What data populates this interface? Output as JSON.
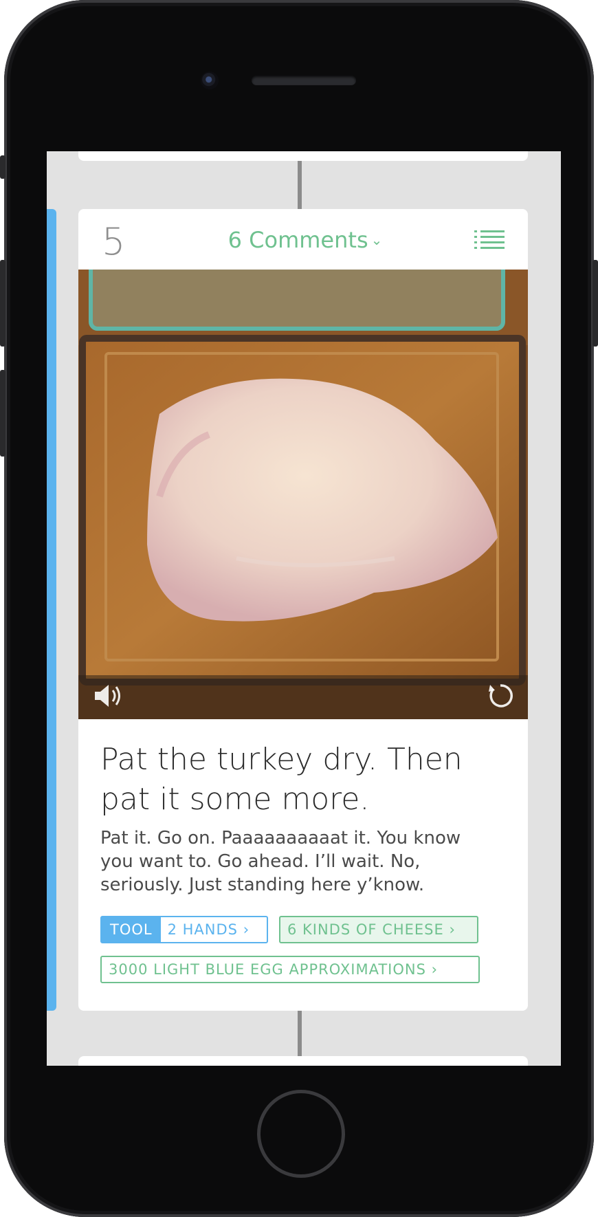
{
  "step": {
    "number": "5",
    "comments_label": "6 Comments",
    "title": "Pat the turkey dry. Then pat it some more.",
    "body": "Pat it. Go on. Paaaaaaaaaat it. You know you want to. Go ahead. I’ll wait. No, seriously. Just standing here y’know."
  },
  "tags": {
    "tool_kind": "TOOL",
    "tool_name": "2 HANDS",
    "ingredient_1": "6 KINDS OF CHEESE",
    "ingredient_2": "3000 LIGHT BLUE EGG APPROXIMATIONS",
    "chevron": "›"
  },
  "icons": {
    "comments_chevron": "chevron-down-icon",
    "steps_list": "list-icon",
    "volume": "volume-icon",
    "replay": "replay-icon"
  },
  "colors": {
    "accent_blue": "#5bb3ee",
    "accent_green": "#6fc18f",
    "step_number_gray": "#8e8e8e",
    "screen_background": "#e2e2e2"
  }
}
